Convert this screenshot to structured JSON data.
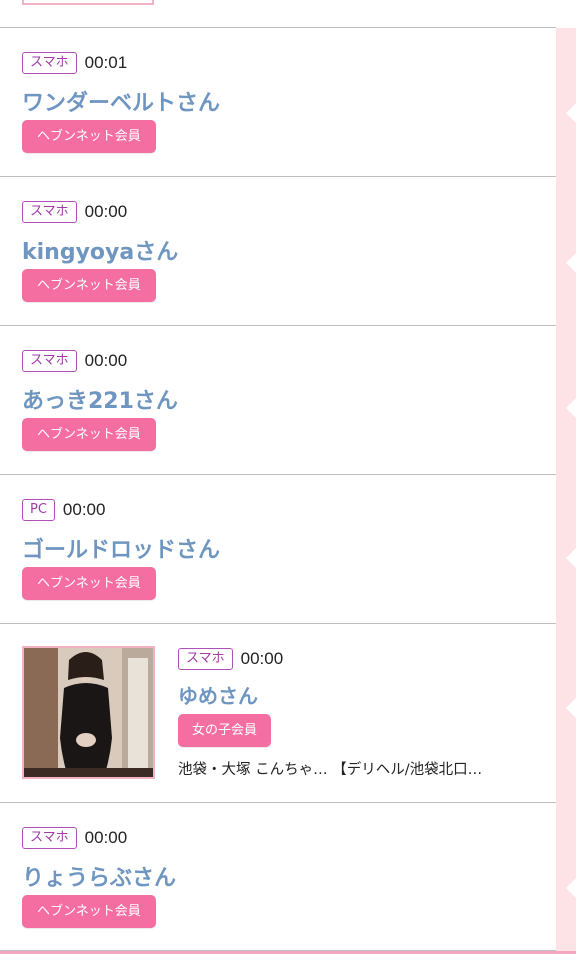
{
  "colors": {
    "accent_pink": "#f56ea2",
    "name_blue": "#6f96c0",
    "device_purple": "#a23aa8",
    "side_strip": "#fde3e6"
  },
  "entries": [
    {
      "device": "スマホ",
      "time": "00:01",
      "name": "ワンダーベルトさん",
      "badge": "ヘブンネット会員"
    },
    {
      "device": "スマホ",
      "time": "00:00",
      "name": "kingyoyaさん",
      "badge": "ヘブンネット会員"
    },
    {
      "device": "スマホ",
      "time": "00:00",
      "name": "あっき221さん",
      "badge": "ヘブンネット会員"
    },
    {
      "device": "PC",
      "time": "00:00",
      "name": "ゴールドロッドさん",
      "badge": "ヘブンネット会員"
    },
    {
      "device": "スマホ",
      "time": "00:00",
      "name": "ゆめさん",
      "badge": "女の子会員",
      "description": "池袋・大塚 こんちゃ… 【デリヘル/池袋北口…",
      "photo": "member-photo"
    },
    {
      "device": "スマホ",
      "time": "00:00",
      "name": "りょうらぶさん",
      "badge": "ヘブンネット会員"
    }
  ]
}
